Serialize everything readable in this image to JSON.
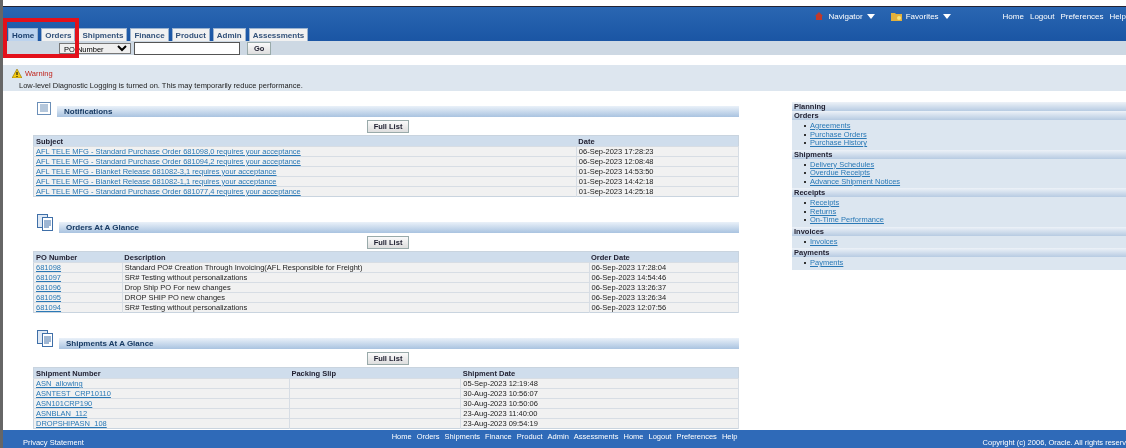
{
  "navigator": {
    "label": "Navigator"
  },
  "favorites": {
    "label": "Favorites"
  },
  "global_links": [
    "Home",
    "Logout",
    "Preferences",
    "Help"
  ],
  "tabs": [
    {
      "label": "Home",
      "selected": true,
      "highlighted": true
    },
    {
      "label": "Orders",
      "selected": false,
      "highlighted": true
    },
    {
      "label": "Shipments",
      "selected": false,
      "highlighted": false
    },
    {
      "label": "Finance",
      "selected": false,
      "highlighted": false
    },
    {
      "label": "Product",
      "selected": false,
      "highlighted": false
    },
    {
      "label": "Admin",
      "selected": false,
      "highlighted": false
    },
    {
      "label": "Assessments",
      "selected": false,
      "highlighted": false
    }
  ],
  "search": {
    "value": "PO Number",
    "button": "Go"
  },
  "warning": {
    "title": "Warning",
    "message": "Low-level Diagnostic Logging is turned on. This may temporarily reduce performance."
  },
  "sections": [
    {
      "title": "Notifications",
      "kind": "list",
      "button": "Full List",
      "columns": [
        "Subject",
        "Date"
      ],
      "rows": [
        [
          "AFL TELE MFG - Standard Purchase Order 681098,0 requires your acceptance",
          "06-Sep-2023 17:28:23"
        ],
        [
          "AFL TELE MFG - Standard Purchase Order 681094,2 requires your acceptance",
          "06-Sep-2023 12:08:48"
        ],
        [
          "AFL TELE MFG - Blanket Release 681082-3,1 requires your acceptance",
          "01-Sep-2023 14:53:50"
        ],
        [
          "AFL TELE MFG - Blanket Release 681082-1,1 requires your acceptance",
          "01-Sep-2023 14:42:18"
        ],
        [
          "AFL TELE MFG - Standard Purchase Order 681077,4 requires your acceptance",
          "01-Sep-2023 14:25:18"
        ]
      ]
    },
    {
      "title": "Orders At A Glance",
      "kind": "documents",
      "button": "Full List",
      "columns": [
        "PO Number",
        "Description",
        "Order Date"
      ],
      "rows": [
        [
          "681098",
          "Standard PO# Creation Through Invoicing(AFL Responsible for Freight)",
          "06-Sep-2023 17:28:04"
        ],
        [
          "681097",
          "SR# Testing without personalizations",
          "06-Sep-2023 14:54:46"
        ],
        [
          "681096",
          "Drop Ship PO For new changes",
          "06-Sep-2023 13:26:37"
        ],
        [
          "681095",
          "DROP SHIP PO new changes",
          "06-Sep-2023 13:26:34"
        ],
        [
          "681094",
          "SR# Testing without personalizations",
          "06-Sep-2023 12:07:56"
        ]
      ]
    },
    {
      "title": "Shipments At A Glance",
      "kind": "documents",
      "button": "Full List",
      "columns": [
        "Shipment Number",
        "Packing Slip",
        "Shipment Date"
      ],
      "rows": [
        [
          "ASN_allowing",
          "",
          "05-Sep-2023 12:19:48"
        ],
        [
          "ASNTEST_CRP10110",
          "",
          "30-Aug-2023 10:56:07"
        ],
        [
          "ASN101CRP190",
          "",
          "30-Aug-2023 10:50:06"
        ],
        [
          "ASNBLAN_112",
          "",
          "23-Aug-2023 11:40:00"
        ],
        [
          "DROPSHIPASN_108",
          "",
          "23-Aug-2023 09:54:19"
        ]
      ]
    }
  ],
  "sidebar": {
    "title": "Planning",
    "groups": [
      {
        "title": "Orders",
        "items": [
          "Agreements",
          "Purchase Orders",
          "Purchase History"
        ]
      },
      {
        "title": "Shipments",
        "items": [
          "Delivery Schedules",
          "Overdue Receipts",
          "Advance Shipment Notices"
        ]
      },
      {
        "title": "Receipts",
        "items": [
          "Receipts",
          "Returns",
          "On-Time Performance"
        ]
      },
      {
        "title": "Invoices",
        "items": [
          "Invoices"
        ]
      },
      {
        "title": "Payments",
        "items": [
          "Payments"
        ]
      }
    ]
  },
  "footer": {
    "links": [
      "Home",
      "Orders",
      "Shipments",
      "Finance",
      "Product",
      "Admin",
      "Assessments",
      "Home",
      "Logout",
      "Preferences",
      "Help"
    ],
    "privacy": "Privacy Statement",
    "copyright": "Copyright (c) 2006, Oracle. All rights reserv"
  }
}
